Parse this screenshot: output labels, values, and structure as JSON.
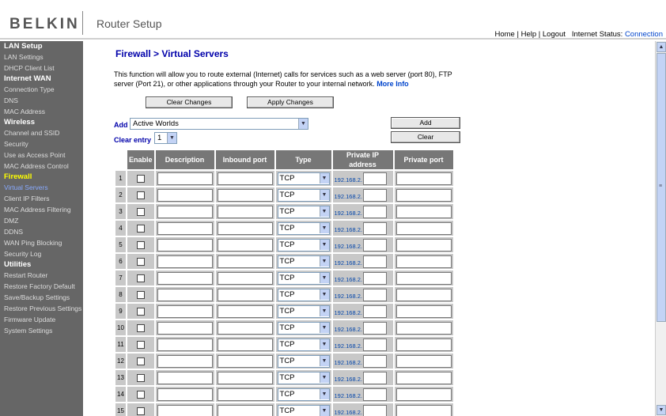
{
  "header": {
    "brand": "BELKIN",
    "app_title": "Router Setup",
    "links": {
      "home": "Home",
      "help": "Help",
      "logout": "Logout",
      "sep": "|"
    },
    "status_label": "Internet Status:",
    "status_value": "Connection"
  },
  "sidebar": {
    "sections": [
      {
        "title": "LAN Setup",
        "items": [
          "LAN Settings",
          "DHCP Client List"
        ]
      },
      {
        "title": "Internet WAN",
        "items": [
          "Connection Type",
          "DNS",
          "MAC Address"
        ]
      },
      {
        "title": "Wireless",
        "items": [
          "Channel and SSID",
          "Security",
          "Use as Access Point",
          "MAC Address Control"
        ]
      },
      {
        "title": "Firewall",
        "items": [
          "Virtual Servers",
          "Client IP Filters",
          "MAC Address Filtering",
          "DMZ",
          "DDNS",
          "WAN Ping Blocking",
          "Security Log"
        ]
      },
      {
        "title": "Utilities",
        "items": [
          "Restart Router",
          "Restore Factory Default",
          "Save/Backup Settings",
          "Restore Previous Settings",
          "Firmware Update",
          "System Settings"
        ]
      }
    ]
  },
  "main": {
    "title": "Firewall > Virtual Servers",
    "intro": "This function will allow you to route external (Internet) calls for services such as a web server (port 80), FTP server (Port 21), or other applications through your Router to your internal network.",
    "more_info": "More Info",
    "clear_changes": "Clear Changes",
    "apply_changes": "Apply Changes",
    "add_label": "Add",
    "add_selected": "Active Worlds",
    "add_button": "Add",
    "clear_entry_label": "Clear entry",
    "clear_entry_selected": "1",
    "clear_button": "Clear"
  },
  "table": {
    "headers": [
      "Enable",
      "Description",
      "Inbound port",
      "Type",
      "Private IP address",
      "Private port"
    ],
    "type_default": "TCP",
    "ip_prefix": "192.168.2.",
    "rows": [
      "1",
      "2",
      "3",
      "4",
      "5",
      "6",
      "7",
      "8",
      "9",
      "10",
      "11",
      "12",
      "13",
      "14",
      "15"
    ]
  },
  "colors": {
    "sidebar_bg": "#666666",
    "active_section": "#ffff00",
    "active_item": "#88aaff",
    "title_blue": "#0000aa"
  },
  "icons": {
    "dropdown": "chevron-down-icon",
    "scroll_up": "arrow-up-icon",
    "scroll_down": "arrow-down-icon"
  }
}
